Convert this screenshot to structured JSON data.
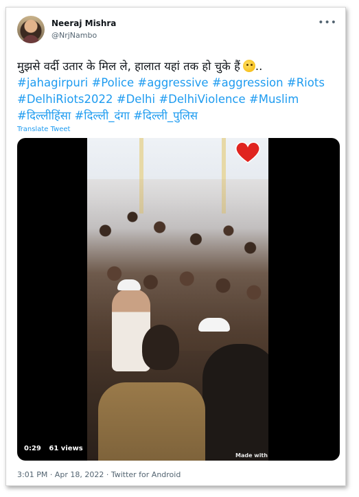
{
  "author": {
    "name": "Neeraj Mishra",
    "handle": "@NrjNambo"
  },
  "more_label": "•••",
  "tweet": {
    "text": "मुझसे वर्दी उतार के मिल ले, हालात यहां तक हो चुके हैं",
    "emoji": "thinking-face-emoji",
    "trail": "..",
    "hashtags": [
      "#jahagirpuri",
      "#Police",
      "#aggressive",
      "#aggression",
      "#Riots",
      "#DelhiRiots2022",
      "#Delhi",
      "#DelhiViolence",
      "#Muslim",
      "#दिल्लीहिंसा",
      "#दिल्ली_दंगा",
      "#दिल्ली_पुलिस"
    ],
    "translate_label": "Translate Tweet"
  },
  "video": {
    "duration": "0:29",
    "views": "61 views",
    "watermark": "Made with",
    "heart_color": "#e0241f"
  },
  "footer": {
    "meta": "3:01 PM · Apr 18, 2022 · Twitter for Android"
  },
  "colors": {
    "link": "#1d9bf0",
    "text": "#0f1419",
    "secondary": "#536471"
  }
}
